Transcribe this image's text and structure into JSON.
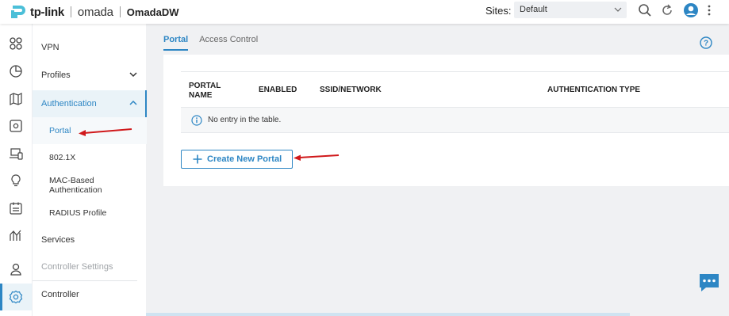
{
  "header": {
    "brand": "tp-link",
    "product": "omada",
    "controller_name": "OmadaDW",
    "sites_label": "Sites:",
    "site_selected": "Default",
    "icons": [
      "search-icon",
      "refresh-icon",
      "user-avatar-icon",
      "more-vertical-icon"
    ]
  },
  "rail": {
    "items": [
      {
        "icon": "dashboard-icon"
      },
      {
        "icon": "statistics-icon"
      },
      {
        "icon": "map-icon"
      },
      {
        "icon": "devices-icon"
      },
      {
        "icon": "clients-icon"
      },
      {
        "icon": "insight-icon"
      },
      {
        "icon": "log-icon"
      },
      {
        "icon": "reports-icon"
      },
      {
        "icon": "account-icon"
      },
      {
        "icon": "settings-icon",
        "active": true
      }
    ]
  },
  "submenu": {
    "items": [
      {
        "label": "VPN"
      },
      {
        "label": "Profiles"
      },
      {
        "label": "Authentication"
      },
      {
        "label": "Portal"
      },
      {
        "label": "802.1X"
      },
      {
        "label": "MAC-Based Authentication"
      },
      {
        "label": "RADIUS Profile"
      },
      {
        "label": "Services"
      },
      {
        "label": "Controller Settings"
      },
      {
        "label": "Controller"
      }
    ]
  },
  "tabs": [
    {
      "label": "Portal",
      "active": true
    },
    {
      "label": "Access Control",
      "active": false
    }
  ],
  "table": {
    "columns": [
      "PORTAL NAME",
      "ENABLED",
      "SSID/NETWORK",
      "AUTHENTICATION TYPE"
    ],
    "empty_message": "No entry in the table."
  },
  "create_button_label": "Create New Portal",
  "colors": {
    "accent": "#2d86c4",
    "annotation_arrow": "#d0191b",
    "background": "#f0f1f3"
  }
}
